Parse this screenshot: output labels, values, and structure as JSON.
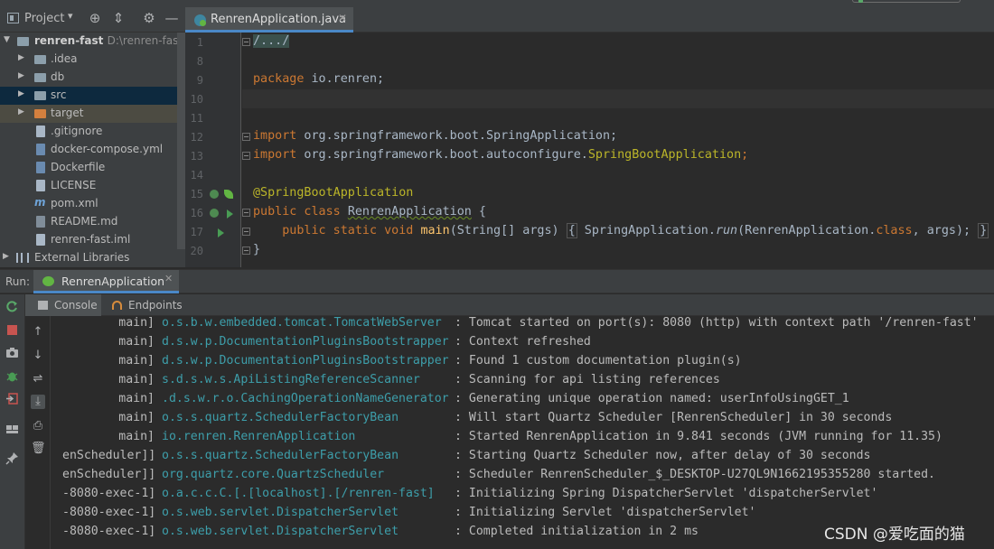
{
  "toolbar": {
    "project_label": "Project",
    "project_caret": "▾",
    "locate_icon": "⊕",
    "collapse_icon": "⇕",
    "settings_icon": "⚙",
    "hide_icon": "—"
  },
  "editor_tab": {
    "label": "RenrenApplication.java",
    "close": "✕"
  },
  "tree": {
    "root": {
      "label": "renren-fast",
      "path": "D:\\renren-fas"
    },
    "items": [
      {
        "label": ".idea"
      },
      {
        "label": "db"
      },
      {
        "label": "src"
      },
      {
        "label": "target"
      },
      {
        "label": ".gitignore"
      },
      {
        "label": "docker-compose.yml"
      },
      {
        "label": "Dockerfile"
      },
      {
        "label": "LICENSE"
      },
      {
        "label": "pom.xml"
      },
      {
        "label": "README.md"
      },
      {
        "label": "renren-fast.iml"
      },
      {
        "label": "External Libraries"
      }
    ]
  },
  "gutter": {
    "line_numbers": [
      "1",
      "8",
      "9",
      "10",
      "11",
      "12",
      "13",
      "14",
      "15",
      "16",
      "17",
      "20"
    ]
  },
  "code": {
    "l1": "/.../",
    "l9_kw": "package",
    "l9_rest": " io.renren;",
    "l12_kw": "import",
    "l12_rest": " org.springframework.boot.SpringApplication;",
    "l13_kw": "import",
    "l13_rest": " org.springframework.boot.autoconfigure.",
    "l13_ann": "SpringBootApplication",
    "l13_end": ";",
    "l15": "@SpringBootApplication",
    "l16_kw": "public class",
    "l16_name": "RenrenApplication",
    "l16_end": " {",
    "l17_kw": "public static void",
    "l17_fn": "main",
    "l17_args": "(String[] args)",
    "l17_open": "{",
    "l17_body1": " SpringApplication.",
    "l17_run": "run",
    "l17_body2": "(RenrenApplication.",
    "l17_class": "class",
    "l17_body3": ", args);",
    "l17_close": "}",
    "l20": "}"
  },
  "run": {
    "label": "Run:",
    "tab_label": "RenrenApplication",
    "tab_close": "✕",
    "subtabs": {
      "console": "Console",
      "endpoints": "Endpoints"
    }
  },
  "log": [
    {
      "thread": "main]",
      "logger": "o.s.b.w.embedded.tomcat.TomcatWebServer",
      "msg": ": Tomcat started on port(s): 8080 (http) with context path '/renren-fast'"
    },
    {
      "thread": "main]",
      "logger": "d.s.w.p.DocumentationPluginsBootstrapper",
      "msg": ": Context refreshed"
    },
    {
      "thread": "main]",
      "logger": "d.s.w.p.DocumentationPluginsBootstrapper",
      "msg": ": Found 1 custom documentation plugin(s)"
    },
    {
      "thread": "main]",
      "logger": "s.d.s.w.s.ApiListingReferenceScanner",
      "msg": ": Scanning for api listing references"
    },
    {
      "thread": "main]",
      "logger": ".d.s.w.r.o.CachingOperationNameGenerator",
      "msg": ": Generating unique operation named: userInfoUsingGET_1"
    },
    {
      "thread": "main]",
      "logger": "o.s.s.quartz.SchedulerFactoryBean",
      "msg": ": Will start Quartz Scheduler [RenrenScheduler] in 30 seconds"
    },
    {
      "thread": "main]",
      "logger": "io.renren.RenrenApplication",
      "msg": ": Started RenrenApplication in 9.841 seconds (JVM running for 11.35)"
    },
    {
      "thread": "enScheduler]]",
      "logger": "o.s.s.quartz.SchedulerFactoryBean",
      "msg": ": Starting Quartz Scheduler now, after delay of 30 seconds"
    },
    {
      "thread": "enScheduler]]",
      "logger": "org.quartz.core.QuartzScheduler",
      "msg": ": Scheduler RenrenScheduler_$_DESKTOP-U27QL9N1662195355280 started."
    },
    {
      "thread": "-8080-exec-1]",
      "logger": "o.a.c.c.C.[.[localhost].[/renren-fast]",
      "msg": ": Initializing Spring DispatcherServlet 'dispatcherServlet'"
    },
    {
      "thread": "-8080-exec-1]",
      "logger": "o.s.web.servlet.DispatcherServlet",
      "msg": ": Initializing Servlet 'dispatcherServlet'"
    },
    {
      "thread": "-8080-exec-1]",
      "logger": "o.s.web.servlet.DispatcherServlet",
      "msg": ": Completed initialization in 2 ms"
    }
  ],
  "watermark": "CSDN @爱吃面的猫",
  "colors": {
    "keyword": "#cc7832",
    "annotation": "#bbb529",
    "logger": "#3d9eaa",
    "accent": "#4a88c7",
    "run_green": "#499c54"
  }
}
